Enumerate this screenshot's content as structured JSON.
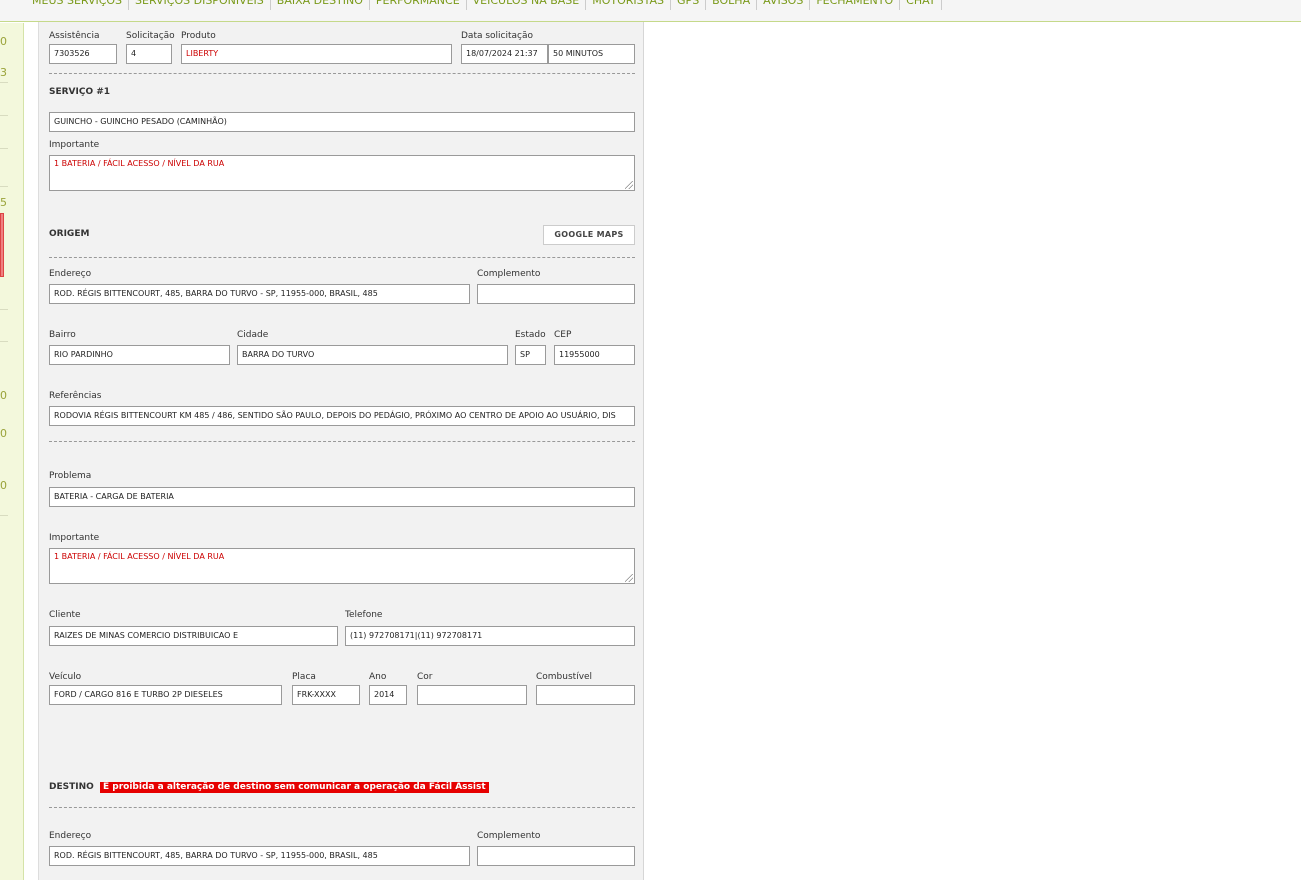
{
  "nav": {
    "items": [
      "MEUS SERVIÇOS",
      "SERVIÇOS DISPONÍVEIS",
      "BAIXA DESTINO",
      "PERFORMANCE",
      "VEÍCULOS NA BASE",
      "MOTORISTAS",
      "GPS",
      "BOLHA",
      "AVISOS",
      "FECHAMENTO",
      "CHAT"
    ]
  },
  "sidebar": {
    "marks": [
      "0",
      "3",
      "5",
      "0",
      "0",
      "0"
    ]
  },
  "header": {
    "assistencia_label": "Assistência",
    "assistencia_value": "7303526",
    "solicitacao_label": "Solicitação",
    "solicitacao_value": "4",
    "produto_label": "Produto",
    "produto_value": "LIBERTY",
    "data_label": "Data solicitação",
    "data_value": "18/07/2024 21:37",
    "tempo_value": "50 MINUTOS"
  },
  "servico": {
    "title": "SERVIÇO #1",
    "value": "GUINCHO - GUINCHO PESADO (CAMINHÃO)",
    "importante_label": "Importante",
    "importante_value": "1 BATERIA / FÁCIL ACESSO / NÍVEL DA RUA"
  },
  "origem": {
    "title": "ORIGEM",
    "maps_button": "GOOGLE MAPS",
    "endereco_label": "Endereço",
    "endereco_value": "ROD. RÉGIS BITTENCOURT, 485, BARRA DO TURVO - SP, 11955-000, BRASIL, 485",
    "complemento_label": "Complemento",
    "complemento_value": "",
    "bairro_label": "Bairro",
    "bairro_value": "RIO PARDINHO",
    "cidade_label": "Cidade",
    "cidade_value": "BARRA DO TURVO",
    "estado_label": "Estado",
    "estado_value": "SP",
    "cep_label": "CEP",
    "cep_value": "11955000",
    "referencias_label": "Referências",
    "referencias_value": "RODOVIA RÉGIS BITTENCOURT KM 485 / 486, SENTIDO SÃO PAULO, DEPOIS DO PEDÁGIO, PRÓXIMO AO CENTRO DE APOIO AO USUÁRIO, DIS"
  },
  "problema": {
    "problema_label": "Problema",
    "problema_value": "BATERIA - CARGA DE BATERIA",
    "importante_label": "Importante",
    "importante_value": "1 BATERIA / FÁCIL ACESSO / NÍVEL DA RUA",
    "cliente_label": "Cliente",
    "cliente_value": "RAIZES DE MINAS COMERCIO DISTRIBUICAO E",
    "telefone_label": "Telefone",
    "telefone_value": "(11) 972708171|(11) 972708171",
    "veiculo_label": "Veículo",
    "veiculo_value": "FORD / CARGO 816 E TURBO 2P DIESELES",
    "placa_label": "Placa",
    "placa_value": "FRK-XXXX",
    "ano_label": "Ano",
    "ano_value": "2014",
    "cor_label": "Cor",
    "cor_value": "",
    "combustivel_label": "Combustível",
    "combustivel_value": ""
  },
  "destino": {
    "title": "DESTINO",
    "warning": "É proibida a alteração de destino sem comunicar a operação da Fácil Assist",
    "endereco_label": "Endereço",
    "endereco_value": "ROD. RÉGIS BITTENCOURT, 485, BARRA DO TURVO - SP, 11955-000, BRASIL, 485",
    "complemento_label": "Complemento",
    "complemento_value": ""
  },
  "colors": {
    "accent": "#7a9a1a",
    "required_text": "#cc0000",
    "warning_bg": "#e60000",
    "panel_bg": "#f2f2f2"
  }
}
